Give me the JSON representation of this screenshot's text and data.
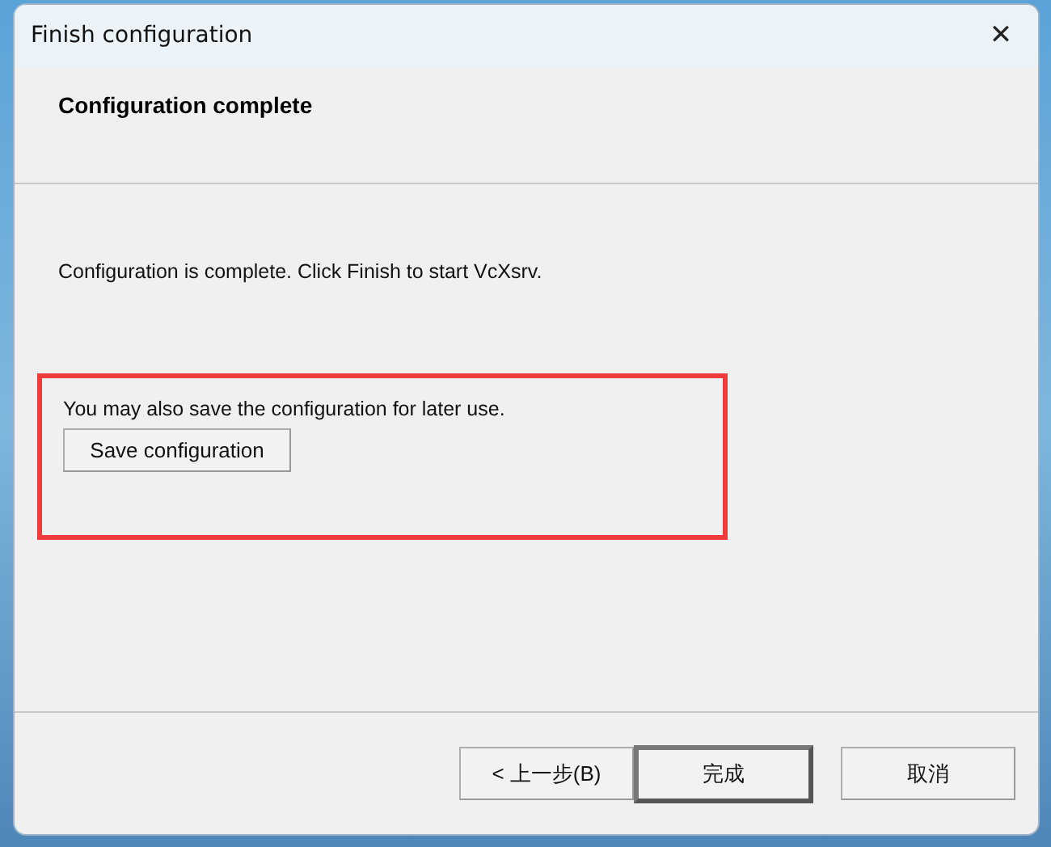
{
  "window": {
    "title": "Finish configuration",
    "close": "✕"
  },
  "header": {
    "title": "Configuration complete"
  },
  "body": {
    "message": "Configuration is complete. Click Finish to start VcXsrv.",
    "save_section": {
      "highlighted": true,
      "hint": "You may also save the configuration for later use.",
      "button": "Save configuration"
    }
  },
  "buttons": [
    {
      "label": "< 上一步(B)",
      "default": false
    },
    {
      "label": "完成",
      "default": true
    },
    {
      "label": "取消",
      "default": false
    }
  ]
}
